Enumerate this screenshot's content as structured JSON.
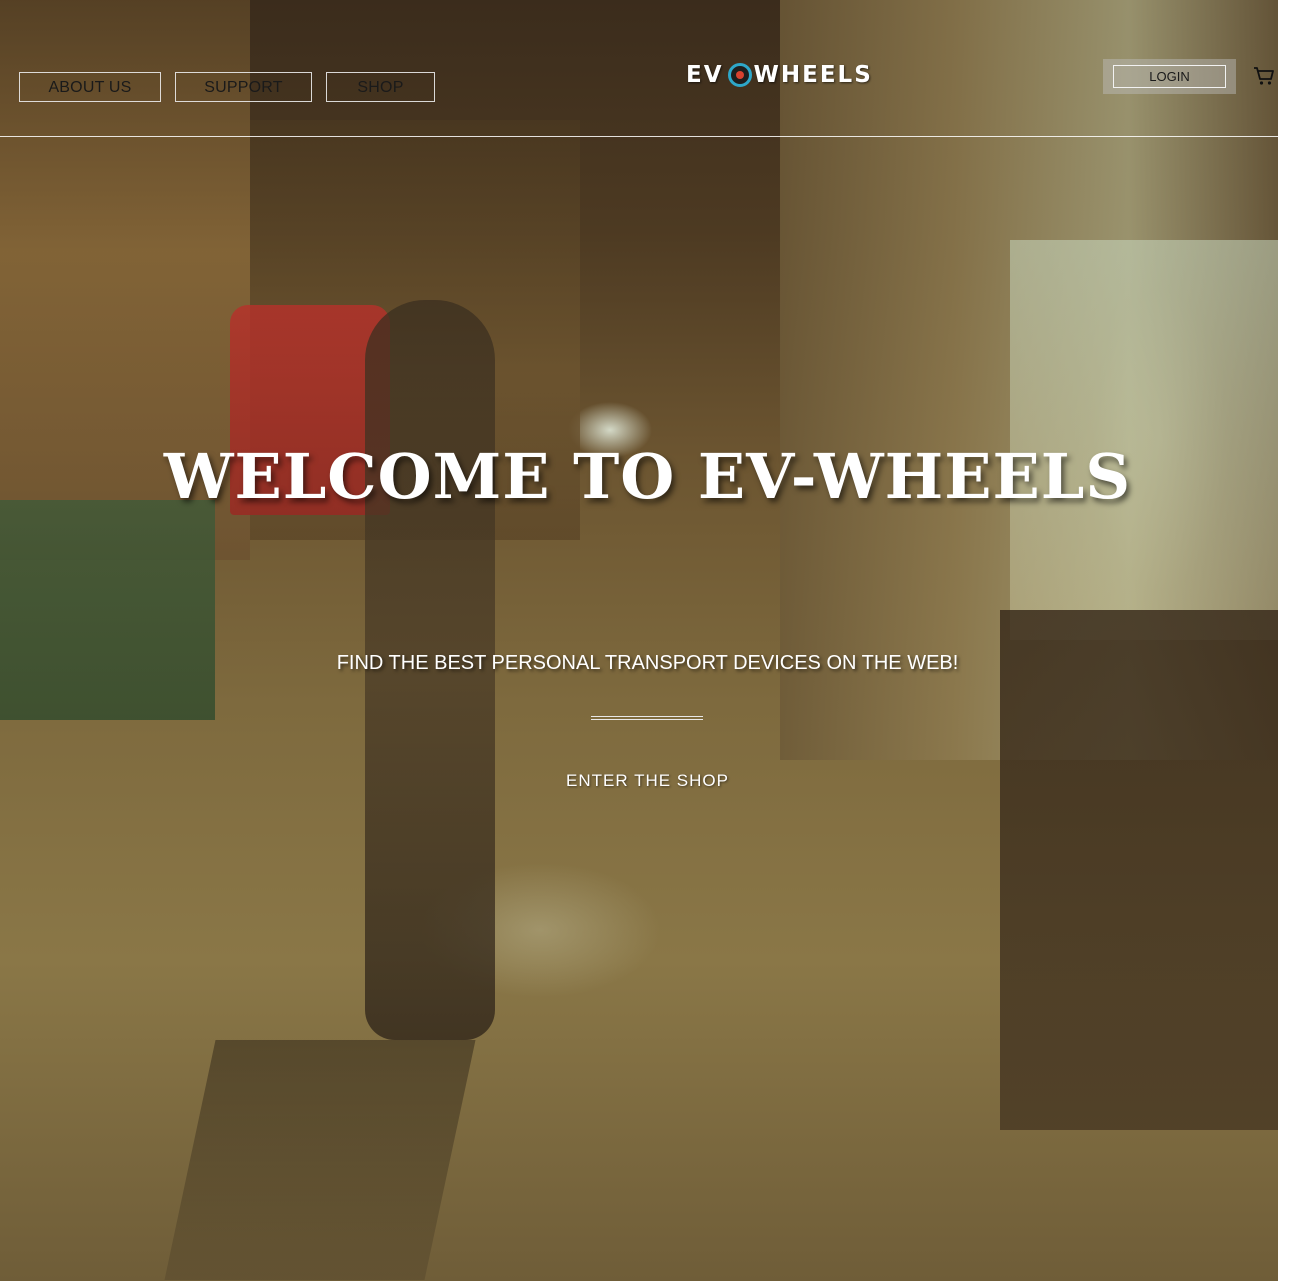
{
  "nav": {
    "about_label": "ABOUT US",
    "support_label": "SUPPORT",
    "shop_label": "SHOP"
  },
  "logo": {
    "left_text": "EV",
    "right_text": "WHEELS",
    "wheel_icon": "wheel-icon"
  },
  "account": {
    "login_label": "LOGIN",
    "cart_icon": "cart-icon"
  },
  "hero": {
    "title": "WELCOME TO EV-WHEELS",
    "subtitle": "FIND THE BEST PERSONAL TRANSPORT DEVICES ON THE WEB!",
    "cta_label": "ENTER THE SHOP"
  },
  "colors": {
    "accent_wheel_ring": "#2ea7c9",
    "accent_wheel_hub": "#d8412f",
    "text_light": "#ffffff"
  }
}
